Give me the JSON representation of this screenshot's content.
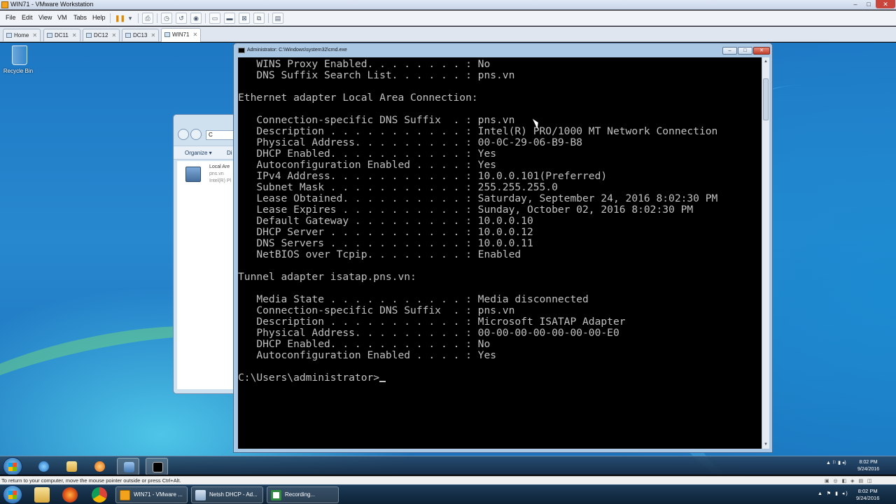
{
  "host": {
    "title": "WIN71 - VMware Workstation",
    "controls": {
      "minimize": "–",
      "maximize": "□",
      "close": "✕"
    },
    "menu": [
      "File",
      "Edit",
      "View",
      "VM",
      "Tabs",
      "Help"
    ],
    "toolbar_icons": [
      "pause-icon",
      "dropdown-arrow-icon",
      "send-ctrl-alt-del-icon",
      "snapshot-icon",
      "revert-snapshot-icon",
      "snapshot-manager-icon",
      "fullscreen-icon",
      "unity-icon",
      "console-view-icon",
      "thumbnail-icon",
      "library-icon"
    ],
    "tabs": [
      {
        "label": "Home"
      },
      {
        "label": "DC11"
      },
      {
        "label": "DC12"
      },
      {
        "label": "DC13"
      },
      {
        "label": "WIN71"
      }
    ],
    "tab_close": "✕",
    "active_tab": "WIN71",
    "statusbar_message": "To return to your computer, move the mouse pointer outside or press Ctrl+Alt."
  },
  "guest": {
    "desktop": {
      "recycle_bin_label": "Recycle Bin"
    },
    "explorer": {
      "address": "C",
      "organize": "Organize ▾",
      "organize_cut": "Di",
      "connection": {
        "name": "Local Are",
        "domain": "pns.vn",
        "adapter": "Intel(R) Pl"
      }
    },
    "cmd": {
      "title": "Administrator: C:\\Windows\\system32\\cmd.exe",
      "controls": {
        "minimize": "–",
        "maximize": "□",
        "close": "✕"
      },
      "lines": [
        "   WINS Proxy Enabled. . . . . . . . : No",
        "   DNS Suffix Search List. . . . . . : pns.vn",
        "",
        "Ethernet adapter Local Area Connection:",
        "",
        "   Connection-specific DNS Suffix  . : pns.vn",
        "   Description . . . . . . . . . . . : Intel(R) PRO/1000 MT Network Connection",
        "   Physical Address. . . . . . . . . : 00-0C-29-06-B9-B8",
        "   DHCP Enabled. . . . . . . . . . . : Yes",
        "   Autoconfiguration Enabled . . . . : Yes",
        "   IPv4 Address. . . . . . . . . . . : 10.0.0.101(Preferred)",
        "   Subnet Mask . . . . . . . . . . . : 255.255.255.0",
        "   Lease Obtained. . . . . . . . . . : Saturday, September 24, 2016 8:02:30 PM",
        "   Lease Expires . . . . . . . . . . : Sunday, October 02, 2016 8:02:30 PM",
        "   Default Gateway . . . . . . . . . : 10.0.0.10",
        "   DHCP Server . . . . . . . . . . . : 10.0.0.12",
        "   DNS Servers . . . . . . . . . . . : 10.0.0.11",
        "   NetBIOS over Tcpip. . . . . . . . : Enabled",
        "",
        "Tunnel adapter isatap.pns.vn:",
        "",
        "   Media State . . . . . . . . . . . : Media disconnected",
        "   Connection-specific DNS Suffix  . : pns.vn",
        "   Description . . . . . . . . . . . : Microsoft ISATAP Adapter",
        "   Physical Address. . . . . . . . . : 00-00-00-00-00-00-00-E0",
        "   DHCP Enabled. . . . . . . . . . . : No",
        "   Autoconfiguration Enabled . . . . : Yes",
        ""
      ],
      "prompt": "C:\\Users\\administrator>",
      "scroll_up": "▲",
      "scroll_down": "▼"
    },
    "taskbar": {
      "pinned_icons": [
        "internet-explorer-icon",
        "file-explorer-icon",
        "media-player-icon",
        "network-connections-icon",
        "command-prompt-icon"
      ],
      "tray": "▲ ⚐ ▮ ◂)",
      "time": "8:02 PM",
      "date": "9/24/2016"
    }
  },
  "host_taskbar": {
    "pinned_icons": [
      "file-explorer-icon",
      "firefox-icon",
      "chrome-icon"
    ],
    "windows": [
      {
        "label": "WIN71 - VMware ...",
        "icon": "vmware-icon"
      },
      {
        "label": "Netsh DHCP - Ad...",
        "icon": "document-icon"
      },
      {
        "label": "Recording...",
        "icon": "camtasia-icon"
      }
    ],
    "tray": "▲ ⚑ ▮ ◂)",
    "time": "8:02 PM",
    "date": "9/24/2016"
  },
  "colors": {
    "console_bg": "#000000",
    "console_text": "#c0c0c0",
    "desktop_blue": "#1e78c4",
    "accent_highlight": "#f5d76e"
  }
}
